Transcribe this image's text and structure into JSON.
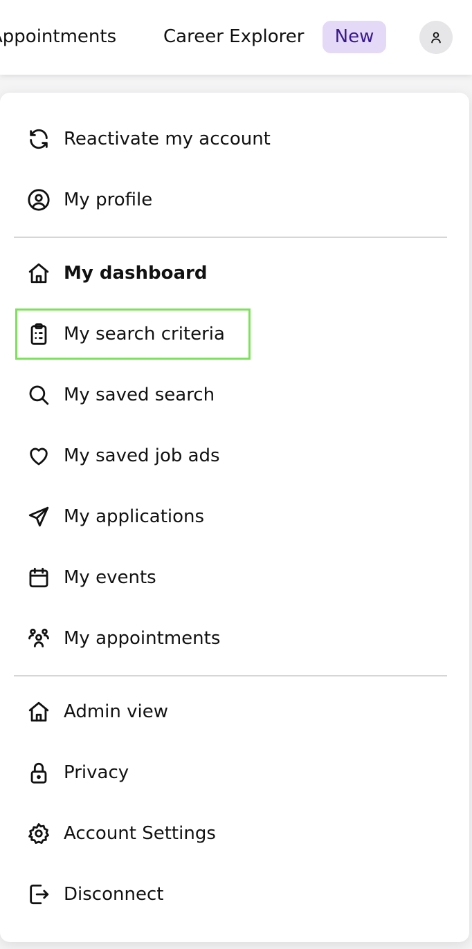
{
  "header": {
    "nav": [
      {
        "label": "Appointments"
      },
      {
        "label": "Career Explorer"
      }
    ],
    "badge": "New",
    "avatar_icon": "user-icon"
  },
  "menu": {
    "group1": [
      {
        "label": "Reactivate my account",
        "icon": "refresh-icon"
      },
      {
        "label": "My profile",
        "icon": "user-circle-icon"
      }
    ],
    "group2": [
      {
        "label": "My dashboard",
        "icon": "home-icon",
        "active": true
      },
      {
        "label": "My search criteria",
        "icon": "clipboard-icon",
        "focused": true
      },
      {
        "label": "My saved search",
        "icon": "search-icon"
      },
      {
        "label": "My saved job ads",
        "icon": "heart-icon"
      },
      {
        "label": "My applications",
        "icon": "send-icon"
      },
      {
        "label": "My events",
        "icon": "calendar-icon"
      },
      {
        "label": "My appointments",
        "icon": "people-icon"
      }
    ],
    "group3": [
      {
        "label": "Admin view",
        "icon": "home-icon"
      },
      {
        "label": "Privacy",
        "icon": "lock-icon"
      },
      {
        "label": "Account Settings",
        "icon": "gear-icon"
      },
      {
        "label": "Disconnect",
        "icon": "logout-icon"
      }
    ]
  },
  "colors": {
    "badge_bg": "#e4d9f7",
    "badge_text": "#3a1a8f",
    "focus_outline": "#7be25a"
  }
}
